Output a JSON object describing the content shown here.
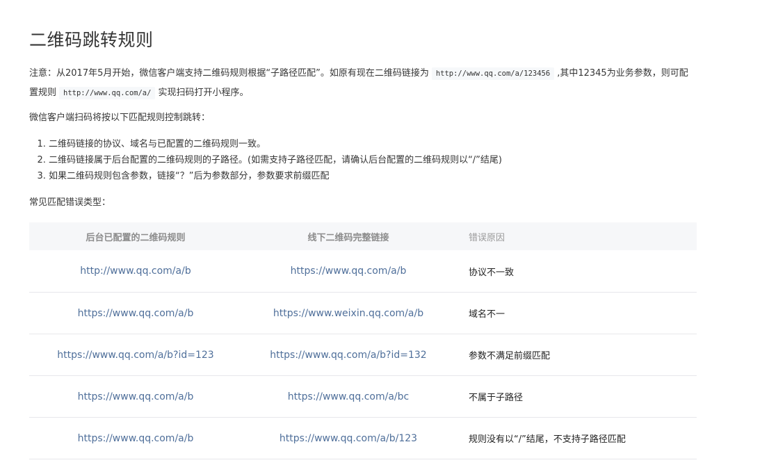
{
  "page": {
    "title": "二维码跳转规则"
  },
  "note": {
    "part1": "注意：从2017年5月开始，微信客户端支持二维码规则根据“子路径匹配”。如原有现在二维码链接为",
    "code1": "http://www.qq.com/a/123456",
    "part2": ",其中12345为业务参数，则可配置规则",
    "code2": "http://www.qq.com/a/",
    "part3": "实现扫码打开小程序。"
  },
  "intro": "微信客户端扫码将按以下匹配规则控制跳转：",
  "rules": [
    "二维码链接的协议、域名与已配置的二维码规则一致。",
    "二维码链接属于后台配置的二维码规则的子路径。(如需支持子路径匹配，请确认后台配置的二维码规则以“/”结尾)",
    "如果二维码规则包含参数，链接“？”后为参数部分，参数要求前缀匹配"
  ],
  "table_title": "常见匹配错误类型：",
  "table": {
    "headers": [
      "后台已配置的二维码规则",
      "线下二维码完整链接",
      "错误原因"
    ],
    "rows": [
      [
        "http://www.qq.com/a/b",
        "https://www.qq.com/a/b",
        "协议不一致"
      ],
      [
        "https://www.qq.com/a/b",
        "https://www.weixin.qq.com/a/b",
        "域名不一"
      ],
      [
        "https://www.qq.com/a/b?id=123",
        "https://www.qq.com/a/b?id=132",
        "参数不满足前缀匹配"
      ],
      [
        "https://www.qq.com/a/b",
        "https://www.qq.com/a/bc",
        "不属于子路径"
      ],
      [
        "https://www.qq.com/a/b",
        "https://www.qq.com/a/b/123",
        "规则没有以“/”结尾，不支持子路径匹配"
      ]
    ]
  }
}
